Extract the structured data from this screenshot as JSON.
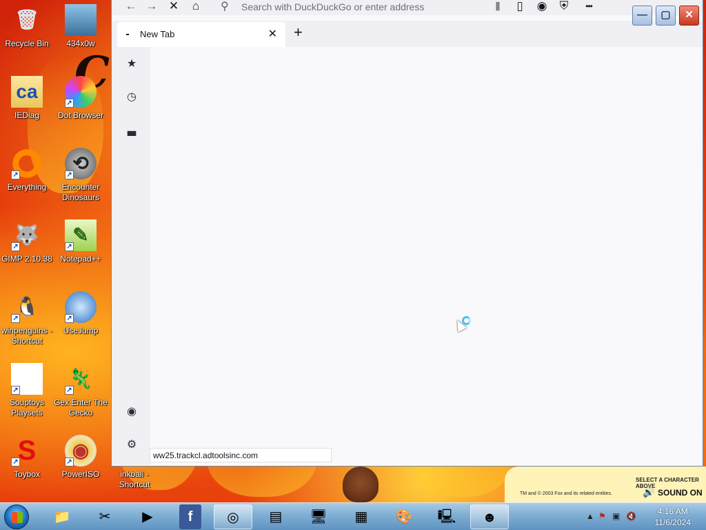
{
  "desktop": {
    "icons": [
      {
        "label": "Recycle Bin",
        "icon": "recycle-bin-icon",
        "shortcut": false
      },
      {
        "label": "434x0w",
        "icon": "image-file-icon",
        "shortcut": false
      },
      {
        "label": "IEDiag",
        "icon": "folder-icon",
        "shortcut": false
      },
      {
        "label": "Dot Browser",
        "icon": "dot-browser-icon",
        "shortcut": true
      },
      {
        "label": "Everything",
        "icon": "everything-search-icon",
        "shortcut": true
      },
      {
        "label": "Encounter Dinosaurs",
        "icon": "dinosaur-game-icon",
        "shortcut": true
      },
      {
        "label": "GIMP 2.10.38",
        "icon": "gimp-icon",
        "shortcut": true
      },
      {
        "label": "Notepad++",
        "icon": "notepadpp-icon",
        "shortcut": true
      },
      {
        "label": "winpenguins - Shortcut",
        "icon": "penguin-icon",
        "shortcut": true
      },
      {
        "label": "UseJump",
        "icon": "usejump-icon",
        "shortcut": true
      },
      {
        "label": "Souptoys Playsets",
        "icon": "blank-file-icon",
        "shortcut": true
      },
      {
        "label": "Gex Enter The Gecko",
        "icon": "gecko-game-icon",
        "shortcut": true
      },
      {
        "label": "Toybox",
        "icon": "toybox-icon",
        "shortcut": true
      },
      {
        "label": "PowerISO",
        "icon": "poweriso-icon",
        "shortcut": true
      },
      {
        "label": "inkball - Shortcut",
        "icon": "inkball-icon",
        "shortcut": true
      }
    ],
    "wallpaper_letter": "Cl"
  },
  "browser": {
    "urlbar": {
      "placeholder": "Search with DuckDuckGo or enter address",
      "value": ""
    },
    "tab": {
      "title": "New Tab",
      "close_glyph": "✕"
    },
    "new_tab_glyph": "+",
    "status_url": "ww25.trackcl.adtoolsinc.com",
    "toolbar_glyphs": {
      "back": "←",
      "forward": "→",
      "stop": "✕",
      "home": "⌂",
      "library": "⫼",
      "sidebar": "▯",
      "account": "◉",
      "shield": "⛨",
      "menu": "•••"
    }
  },
  "banner": {
    "line1": "SELECT A CHARACTER ABOVE",
    "line2": "TM and © 2003 Fox and its related entities.",
    "sound": "SOUND ON"
  },
  "taskbar": {
    "apps": [
      {
        "name": "file-explorer",
        "glyph": "📁",
        "active": false
      },
      {
        "name": "snipping-tool",
        "glyph": "✂",
        "active": false
      },
      {
        "name": "media-player",
        "glyph": "▶",
        "active": false
      },
      {
        "name": "facebook",
        "glyph": "f",
        "active": false
      },
      {
        "name": "dot-browser",
        "glyph": "◎",
        "active": true
      },
      {
        "name": "sticky-notes",
        "glyph": "▤",
        "active": false
      },
      {
        "name": "network-tool",
        "glyph": "🖥",
        "active": false
      },
      {
        "name": "calculator",
        "glyph": "▦",
        "active": false
      },
      {
        "name": "paint",
        "glyph": "🎨",
        "active": false
      },
      {
        "name": "remote-desktop",
        "glyph": "🖳",
        "active": false
      },
      {
        "name": "game-app",
        "glyph": "☻",
        "active": true
      }
    ],
    "clock": {
      "time": "4:16 AM",
      "date": "11/6/2024"
    }
  }
}
